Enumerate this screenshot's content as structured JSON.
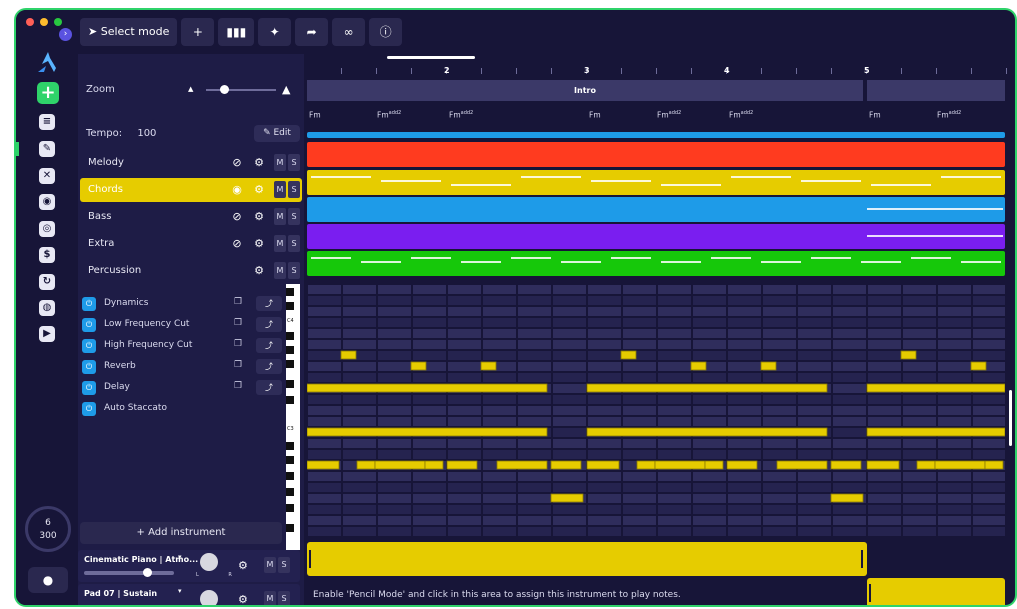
{
  "window": {
    "traffic_lights": [
      "#ff5f57",
      "#febc2e",
      "#28c840"
    ],
    "border_color": "#2fd36a"
  },
  "toolbar": {
    "select_mode_label": "Select mode",
    "icons": [
      "add-icon",
      "bars-icon",
      "wand-icon",
      "route-icon",
      "link-icon",
      "info-icon"
    ]
  },
  "rail": {
    "icons": [
      "edit-icon",
      "pencil-icon",
      "magic-icon",
      "puzzle-icon",
      "radio-icon",
      "dollar-icon",
      "history-icon",
      "discord-icon",
      "play-icon"
    ],
    "dial_top": "6",
    "dial_bottom": "300"
  },
  "zoom": {
    "label": "Zoom",
    "level": 0.25
  },
  "tempo": {
    "label": "Tempo:",
    "value": "100",
    "edit_label": "Edit"
  },
  "tracks": [
    {
      "name": "Melody",
      "color": "#ff3b1f",
      "visible": false
    },
    {
      "name": "Chords",
      "color": "#e6cc00",
      "visible": true,
      "selected": true
    },
    {
      "name": "Bass",
      "color": "#1e9be8",
      "visible": false
    },
    {
      "name": "Extra",
      "color": "#7a1ef0",
      "visible": false
    },
    {
      "name": "Percussion",
      "color": "#16c80a"
    }
  ],
  "ms": {
    "m": "M",
    "s": "S"
  },
  "effects": [
    {
      "name": "Dynamics"
    },
    {
      "name": "Low Frequency Cut"
    },
    {
      "name": "High Frequency Cut"
    },
    {
      "name": "Reverb"
    },
    {
      "name": "Delay"
    },
    {
      "name": "Auto Staccato"
    }
  ],
  "add_instrument": "Add instrument",
  "instruments": [
    {
      "name": "Cinematic Piano | Atmo...",
      "lr": "L R",
      "volume": 0.7
    },
    {
      "name": "Pad 07 | Sustain"
    }
  ],
  "piano": {
    "c4": "C4",
    "c3": "C3"
  },
  "ruler": {
    "bars": [
      "2",
      "3",
      "4",
      "5"
    ]
  },
  "sections": [
    {
      "label": "Intro"
    },
    {
      "label": ""
    }
  ],
  "chords": [
    {
      "root": "Fm",
      "ext": ""
    },
    {
      "root": "Fm",
      "ext": "add2"
    },
    {
      "root": "Fm",
      "ext": "add2"
    },
    {
      "root": "Fm",
      "ext": ""
    },
    {
      "root": "Fm",
      "ext": "add2"
    },
    {
      "root": "Fm",
      "ext": "add2"
    },
    {
      "root": "Fm",
      "ext": ""
    },
    {
      "root": "Fm",
      "ext": "add2"
    }
  ],
  "hint": "Enable 'Pencil Mode' and click in this area to assign this instrument to play notes."
}
